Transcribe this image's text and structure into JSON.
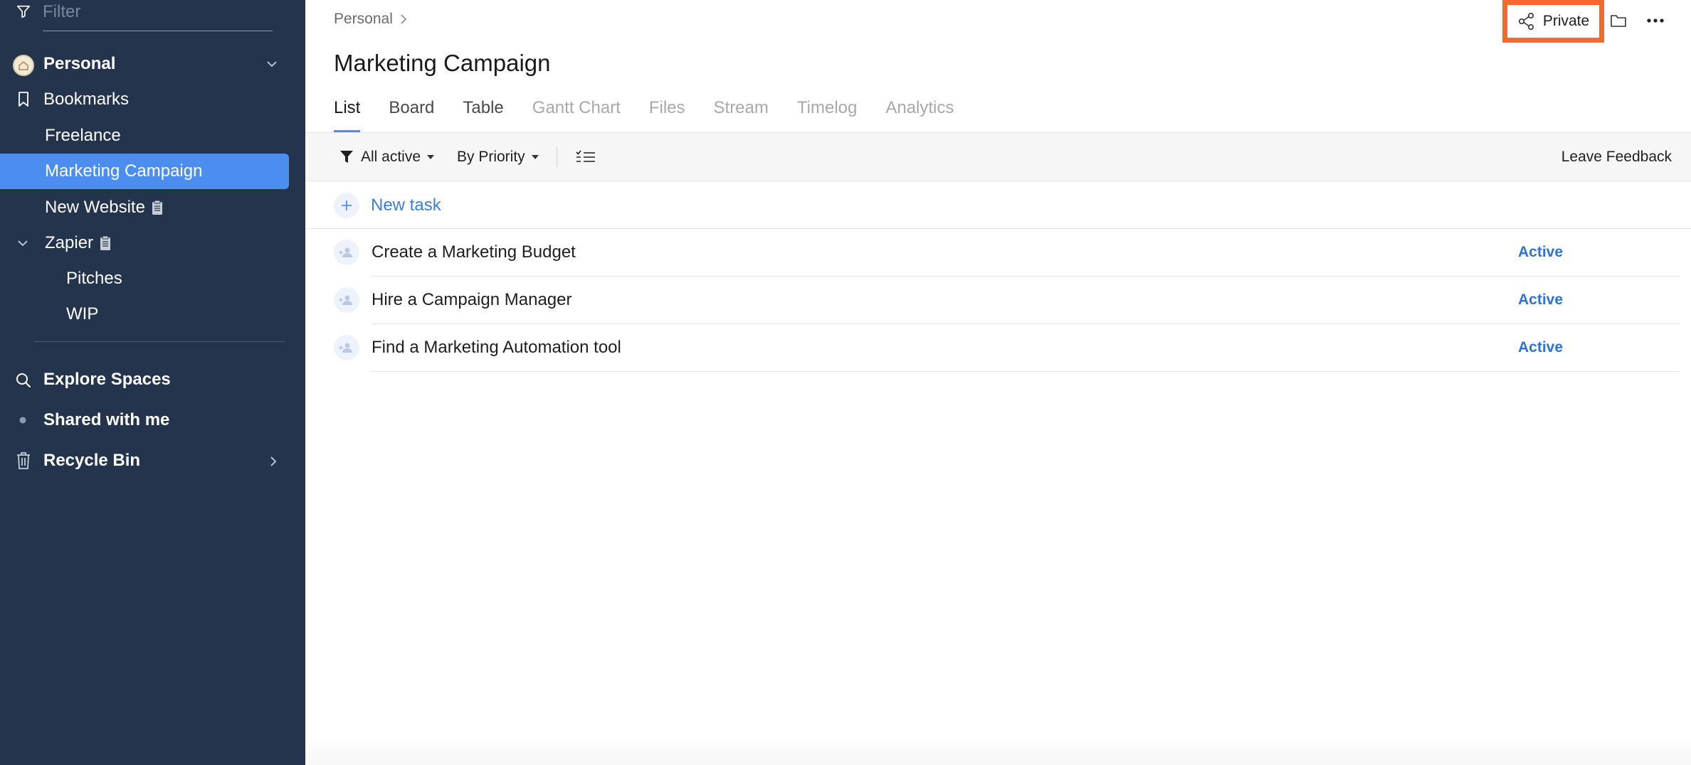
{
  "sidebar": {
    "filter_placeholder": "Filter",
    "space": {
      "label": "Personal"
    },
    "bookmarks": "Bookmarks",
    "projects": [
      {
        "label": "Freelance"
      },
      {
        "label": "Marketing Campaign",
        "active": true
      },
      {
        "label": "New Website"
      },
      {
        "label": "Zapier"
      },
      {
        "label": "Pitches"
      },
      {
        "label": "WIP"
      }
    ],
    "explore": "Explore Spaces",
    "shared": "Shared with me",
    "recycle": "Recycle Bin"
  },
  "header": {
    "breadcrumb": "Personal",
    "title": "Marketing Campaign",
    "private_label": "Private"
  },
  "tabs": [
    {
      "label": "List",
      "active": true
    },
    {
      "label": "Board"
    },
    {
      "label": "Table"
    },
    {
      "label": "Gantt Chart"
    },
    {
      "label": "Files"
    },
    {
      "label": "Stream"
    },
    {
      "label": "Timelog"
    },
    {
      "label": "Analytics"
    }
  ],
  "toolbar": {
    "filter_label": "All active",
    "group_label": "By Priority",
    "feedback_label": "Leave Feedback"
  },
  "tasks": {
    "new_task_label": "New task",
    "items": [
      {
        "title": "Create a Marketing Budget",
        "status": "Active"
      },
      {
        "title": "Hire a Campaign Manager",
        "status": "Active"
      },
      {
        "title": "Find a Marketing Automation tool",
        "status": "Active"
      }
    ]
  },
  "colors": {
    "sidebar_bg": "#23344c",
    "accent": "#4c8ef0",
    "status": "#2f72d6",
    "highlight": "#f26b2c"
  }
}
